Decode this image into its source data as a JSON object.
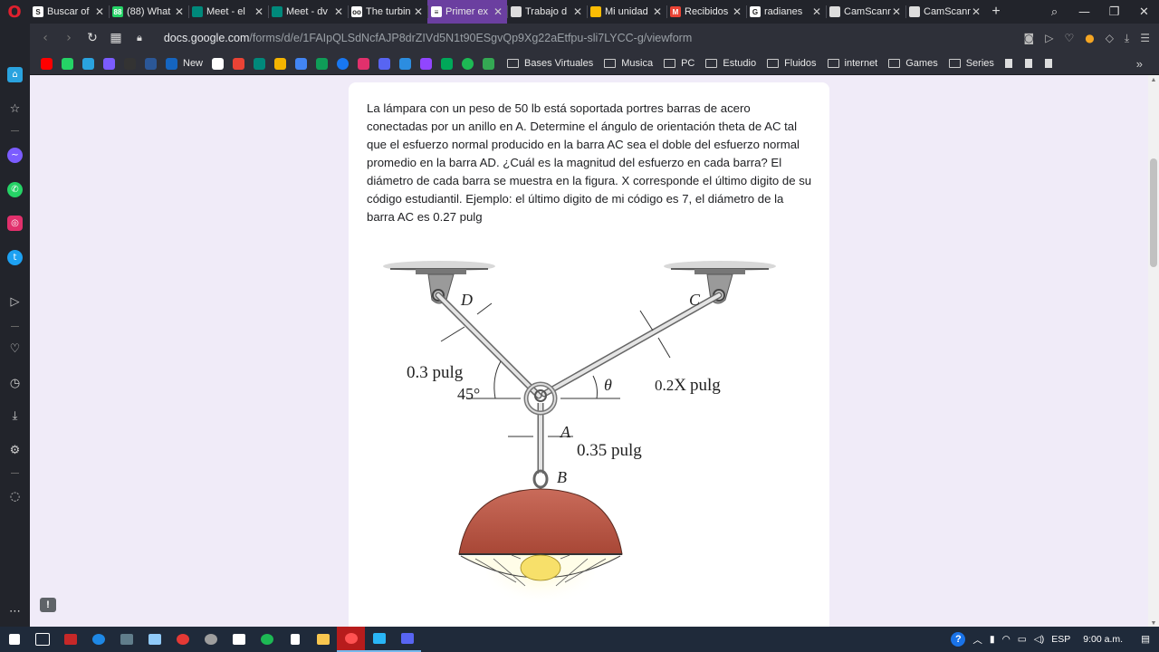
{
  "browser": {
    "tabs": [
      {
        "label": "Buscar of",
        "icon_color": "#ffffff",
        "icon_text": "S"
      },
      {
        "label": "(88) What",
        "icon_color": "#25d366",
        "icon_text": "88"
      },
      {
        "label": "Meet - el",
        "icon_color": "#00897b",
        "icon_text": ""
      },
      {
        "label": "Meet - dv",
        "icon_color": "#00897b",
        "icon_text": ""
      },
      {
        "label": "The turbin",
        "icon_color": "#ffffff",
        "icon_text": "oo"
      },
      {
        "label": "Primer ex",
        "icon_color": "#ffffff",
        "icon_text": "≡",
        "active": true
      },
      {
        "label": "Trabajo d",
        "icon_color": "#dddddd",
        "icon_text": ""
      },
      {
        "label": "Mi unidad",
        "icon_color": "#fbbc04",
        "icon_text": ""
      },
      {
        "label": "Recibidos",
        "icon_color": "#ea4335",
        "icon_text": "M"
      },
      {
        "label": "radianes",
        "icon_color": "#ffffff",
        "icon_text": "G"
      },
      {
        "label": "CamScann",
        "icon_color": "#dddddd",
        "icon_text": ""
      },
      {
        "label": "CamScann",
        "icon_color": "#dddddd",
        "icon_text": ""
      }
    ],
    "url_host": "docs.google.com",
    "url_path": "/forms/d/e/1FAIpQLSdNcfAJP8drZIVd5N1t90ESgvQp9Xg22aEtfpu-sli7LYCC-g/viewform",
    "bookmarks": {
      "new_label": "New",
      "folders": [
        "Bases Virtuales",
        "Musica",
        "PC",
        "Estudio",
        "Fluidos",
        "internet",
        "Games",
        "Series"
      ]
    }
  },
  "question": {
    "text": "La lámpara con un peso de 50 lb está soportada portres barras de acero conectadas por un anillo en A. Determine el ángulo de orientación theta de AC tal que el esfuerzo normal producido en la barra AC sea el doble del esfuerzo normal promedio en la barra AD. ¿Cuál es la magnitud del esfuerzo en cada barra? El diámetro de cada barra se muestra en la figura. X corresponde el último digito de su código estudiantil. Ejemplo: el último digito de mi código es 7, el diámetro de la barra AC es 0.27 pulg"
  },
  "figure": {
    "label_D": "D",
    "label_C": "C",
    "label_A": "A",
    "label_B": "B",
    "dim_AD": "0.3 pulg",
    "angle_AD": "45°",
    "angle_AC": "θ",
    "dim_AC_prefix": "0.2",
    "dim_AC_var": "X",
    "dim_AC_suffix": "pulg",
    "dim_AB": "0.35 pulg"
  },
  "taskbar": {
    "language": "ESP",
    "time": "9:00 a.m."
  }
}
